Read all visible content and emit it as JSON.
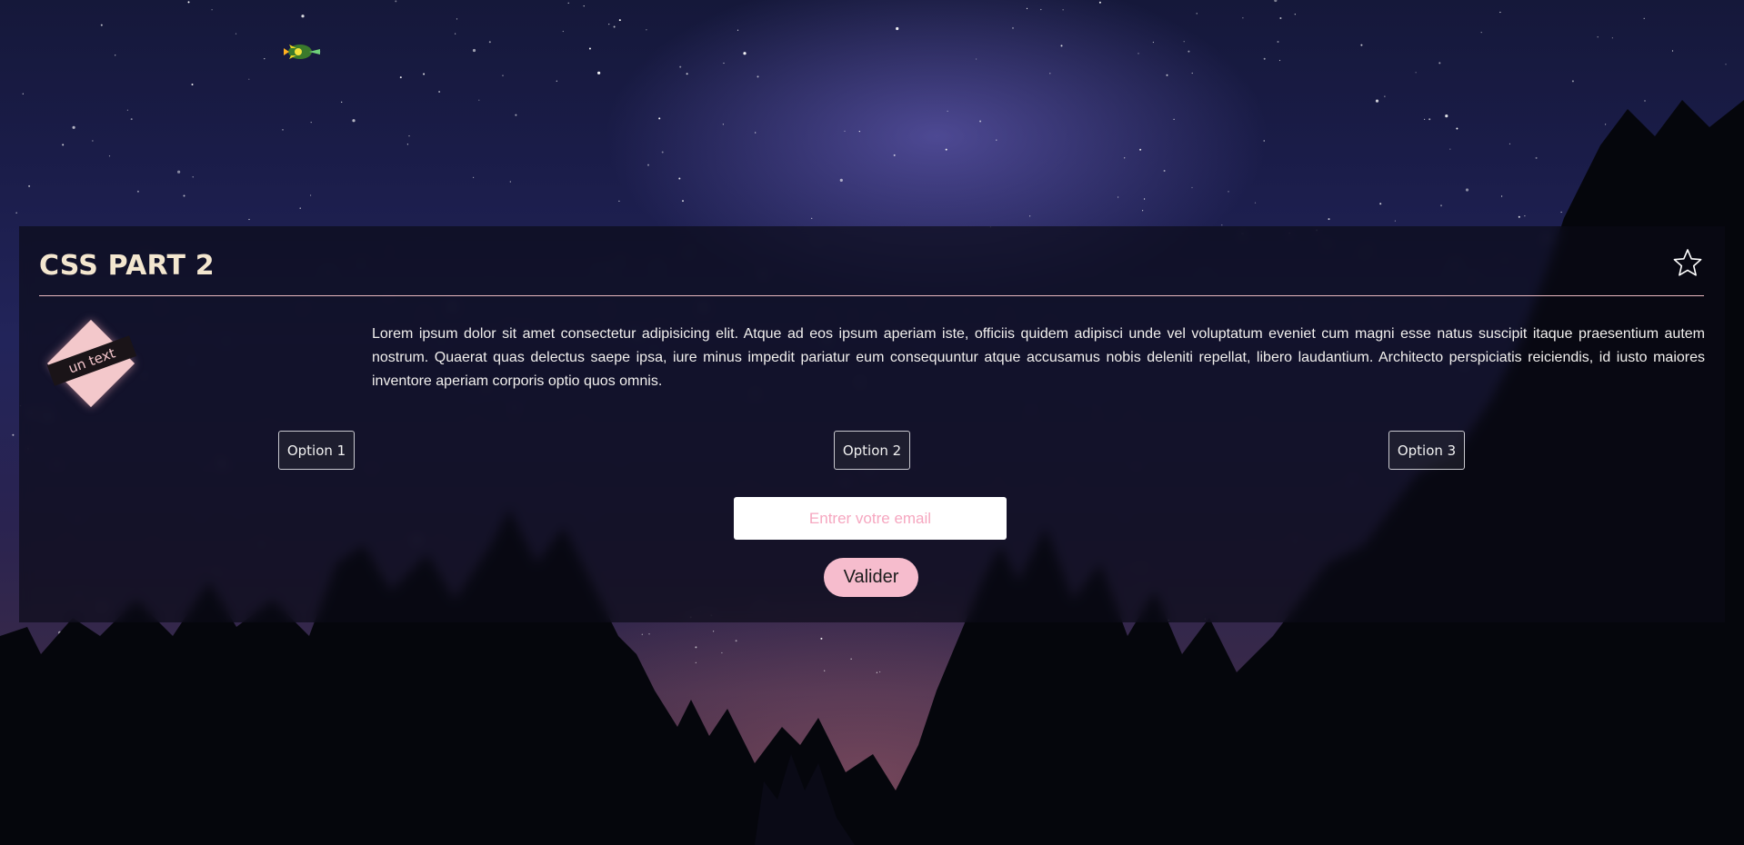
{
  "page": {
    "title": "CSS PART 2",
    "background": "night-sky-with-milky-way-and-pine-trees"
  },
  "header": {
    "star_icon": "star-outline-icon"
  },
  "badge": {
    "text": "un text",
    "color": "#f3c8cb"
  },
  "content": {
    "paragraph": "Lorem ipsum dolor sit amet consectetur adipisicing elit. Atque ad eos ipsum aperiam iste, officiis quidem adipisci unde vel voluptatum eveniet cum magni esse natus suscipit itaque praesentium autem nostrum. Quaerat quas delectus saepe ipsa, iure minus impedit pariatur eum consequuntur atque accusamus nobis deleniti repellat, libero laudantium. Architecto perspiciatis reiciendis, id iusto maiores inventore aperiam corporis optio quos omnis."
  },
  "options": [
    {
      "label": "Option 1"
    },
    {
      "label": "Option 2"
    },
    {
      "label": "Option 3"
    }
  ],
  "form": {
    "email_placeholder": "Entrer votre email",
    "email_value": "",
    "submit_label": "Valider"
  },
  "colors": {
    "accent": "#f6bccd",
    "title": "#f3e6cf",
    "divider": "#e9b8bf"
  }
}
